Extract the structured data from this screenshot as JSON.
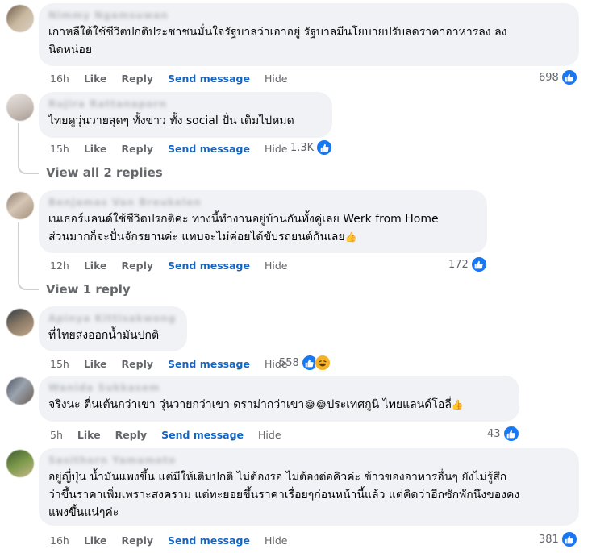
{
  "comments": [
    {
      "author": "Nimmy Ngamsuwan",
      "text": "เกาหลีใต้ใช้ชีวิตปกติประชาชนมั่นใจรัฐบาลว่าเอาอยู่ รัฐบาลมีนโยบายปรับลดราคาอาหารลง ลง\nนิดหน่อย",
      "time": "16h",
      "like": "Like",
      "reply": "Reply",
      "send": "Send message",
      "hide": "Hide",
      "reactions": "698"
    },
    {
      "author": "Rujira Rattanaporn",
      "text": "ไทยดูวุ่นวายสุดๆ ทั้งข่าว ทั้ง social ปั่น เต็มไปหมด",
      "time": "15h",
      "like": "Like",
      "reply": "Reply",
      "send": "Send message",
      "hide": "Hide",
      "reactions": "1.3K",
      "replies": "View all 2 replies"
    },
    {
      "author": "Benjamas Van Breukelen",
      "text": "เนเธอร์แลนด์ใช้ชีวิตปรกติค่ะ ทางนี้ทำงานอยู่บ้านกันทั้งคู่เลย Werk from Home\nส่วนมากก็จะปั่นจักรยานค่ะ แทบจะไม่ค่อยได้ขับรถยนต์กันเลย",
      "emoji": "👍",
      "time": "12h",
      "like": "Like",
      "reply": "Reply",
      "send": "Send message",
      "hide": "Hide",
      "reactions": "172",
      "replies": "View 1 reply"
    },
    {
      "author": "Apinya Kittisakwong",
      "text": "ที่ไทยส่งออกน้ำมันปกติ",
      "time": "15h",
      "like": "Like",
      "reply": "Reply",
      "send": "Send message",
      "hide": "Hide",
      "reactions": "558"
    },
    {
      "author": "Wanida Sukkasem",
      "text": "จริงนะ ตื่นเต้นกว่าเขา วุ่นวายกว่าเขา ดราม่ากว่าเขา",
      "text2": "ประเทศกูนิ ไทยแลนด์โอลี่",
      "emoji_mid": "😂😂",
      "emoji": "👍",
      "time": "5h",
      "like": "Like",
      "reply": "Reply",
      "send": "Send message",
      "hide": "Hide",
      "reactions": "43"
    },
    {
      "author": "Sasithorn Yamamoto",
      "text": "อยู่ญี่ปุ่น น้ำมันแพงขึ้น แต่มีให้เติมปกติ ไม่ต้องรอ ไม่ต้องต่อคิวค่ะ ข้าวของอาหารอื่นๆ ยังไม่รู้สึก\nว่าขึ้นราคาเพิ่มเพราะสงคราม แต่ทะยอยขึ้นราคาเรื่อยๆก่อนหน้านี้แล้ว แต่คิดว่าอีกซักพักนึงของคง\nแพงขึ้นแน่ๆค่ะ",
      "time": "16h",
      "like": "Like",
      "reply": "Reply",
      "send": "Send message",
      "hide": "Hide",
      "reactions": "381"
    }
  ],
  "colors": {
    "like_blue": "#1877f2",
    "send_blue": "#1565c0",
    "bubble": "#f0f2f5",
    "muted": "#65676b"
  },
  "icons": {
    "like": "thumbs-up-icon",
    "haha": "haha-emoji-icon"
  }
}
